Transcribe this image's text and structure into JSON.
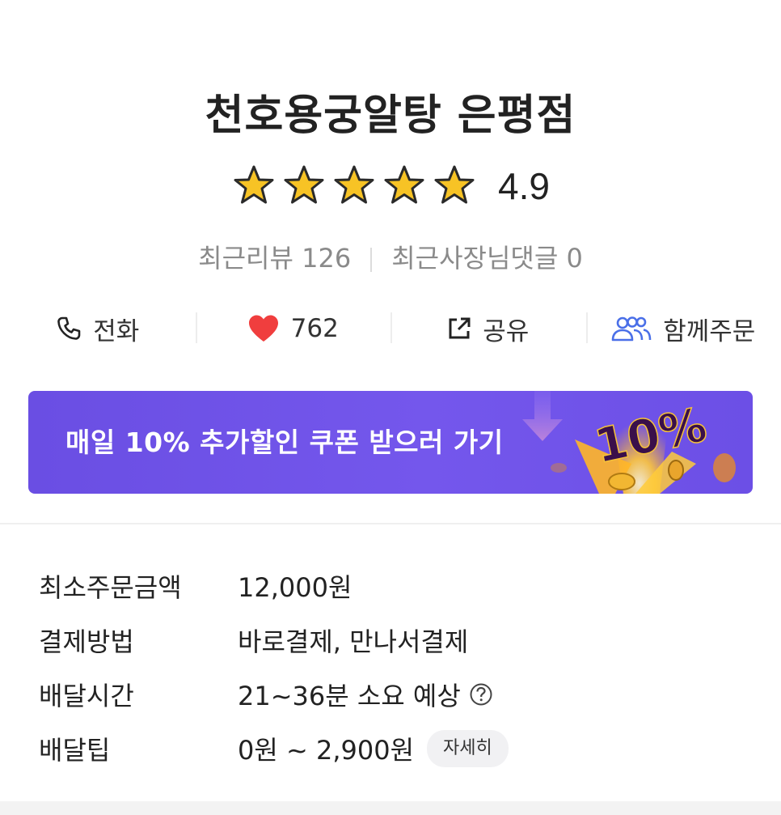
{
  "store": {
    "name": "천호용궁알탕 은평점",
    "rating": "4.9",
    "rating_stars": 5
  },
  "reviews": {
    "recent_reviews": "최근리뷰 126",
    "owner_replies": "최근사장님댓글 0"
  },
  "actions": {
    "call_label": "전화",
    "like_count": "762",
    "share_label": "공유",
    "group_order_label": "함께주문"
  },
  "banner": {
    "text": "매일 10% 추가할인 쿠폰 받으러 가기",
    "badge": "10%"
  },
  "info": {
    "min_order_label": "최소주문금액",
    "min_order_value": "12,000원",
    "payment_label": "결제방법",
    "payment_value": "바로결제, 만나서결제",
    "delivery_time_label": "배달시간",
    "delivery_time_value": "21~36분 소요 예상",
    "delivery_tip_label": "배달팁",
    "delivery_tip_value": "0원 ~ 2,900원",
    "detail_button": "자세히"
  },
  "colors": {
    "banner": "#6a4ee3",
    "star": "#f7c325",
    "heart": "#f03e3e",
    "group_icon": "#4a6fe8"
  }
}
